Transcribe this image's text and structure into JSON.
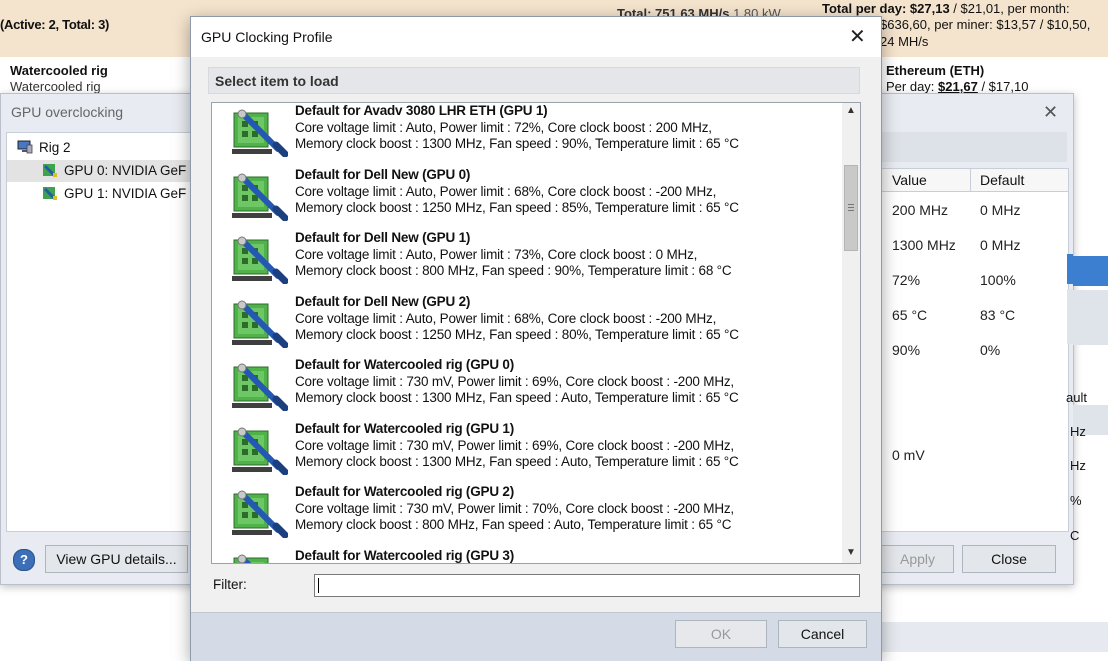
{
  "background": {
    "active_total": "(Active: 2, Total: 3)",
    "rig_name": "Watercooled rig",
    "rig_subname": "Watercooled rig",
    "total_rate_text": "Total: 751,63 MH/s",
    "total_power_text": "1,80 kW",
    "per_day_label": "Total per day:",
    "per_day_value": "$27,13",
    "per_day_rest": "/ $21,01, per month:",
    "per_month_line": "$636,60, per miner: $13,57 / $10,50,",
    "rate_line": "24 MH/s",
    "coin_name": "Ethereum (ETH)",
    "coin_perday_label": "Per day:",
    "coin_perday_value": "$21,67",
    "coin_perday_rest": "/ $17,10"
  },
  "oc_window": {
    "title": "GPU overclocking",
    "tree": {
      "rig": "Rig 2",
      "gpus": [
        "GPU 0: NVIDIA GeF",
        "GPU 1: NVIDIA GeF"
      ]
    },
    "grid": {
      "col_value": "Value",
      "col_default": "Default",
      "rows": [
        {
          "value": "200 MHz",
          "default": "0 MHz"
        },
        {
          "value": "1300 MHz",
          "default": "0 MHz"
        },
        {
          "value": "72%",
          "default": "100%"
        },
        {
          "value": "65 °C",
          "default": "83 °C"
        },
        {
          "value": "90%",
          "default": "0%"
        }
      ],
      "col2_header_fragment": "ault",
      "frag1": "Hz",
      "frag2": "Hz",
      "frag3": "%",
      "frag4": "C",
      "mv_value": "0 mV"
    },
    "buttons": {
      "details": "View GPU details...",
      "apply": "Apply",
      "close": "Close"
    }
  },
  "dialog": {
    "title": "GPU Clocking Profile",
    "section": "Select item to load",
    "items": [
      {
        "name": "Default for Avadv 3080 LHR ETH (GPU 1)",
        "line1": "Core voltage limit : Auto, Power limit : 72%, Core clock boost : 200 MHz,",
        "line2": "Memory clock boost : 1300 MHz, Fan speed : 90%, Temperature limit : 65 °C"
      },
      {
        "name": "Default for Dell New (GPU 0)",
        "line1": "Core voltage limit : Auto, Power limit : 68%, Core clock boost : -200 MHz,",
        "line2": "Memory clock boost : 1250 MHz, Fan speed : 85%, Temperature limit : 65 °C"
      },
      {
        "name": "Default for Dell New (GPU 1)",
        "line1": "Core voltage limit : Auto, Power limit : 73%, Core clock boost : 0 MHz,",
        "line2": "Memory clock boost : 800 MHz, Fan speed : 90%, Temperature limit : 68 °C"
      },
      {
        "name": "Default for Dell New (GPU 2)",
        "line1": "Core voltage limit : Auto, Power limit : 68%, Core clock boost : -200 MHz,",
        "line2": "Memory clock boost : 1250 MHz, Fan speed : 80%, Temperature limit : 65 °C"
      },
      {
        "name": "Default for Watercooled rig (GPU 0)",
        "line1": "Core voltage limit : 730 mV, Power limit : 69%, Core clock boost : -200 MHz,",
        "line2": "Memory clock boost : 1300 MHz, Fan speed : Auto, Temperature limit : 65 °C"
      },
      {
        "name": "Default for Watercooled rig (GPU 1)",
        "line1": "Core voltage limit : 730 mV, Power limit : 69%, Core clock boost : -200 MHz,",
        "line2": "Memory clock boost : 1300 MHz, Fan speed : Auto, Temperature limit : 65 °C"
      },
      {
        "name": "Default for Watercooled rig (GPU 2)",
        "line1": "Core voltage limit : 730 mV, Power limit : 70%, Core clock boost : -200 MHz,",
        "line2": "Memory clock boost : 800 MHz, Fan speed : Auto, Temperature limit : 65 °C"
      },
      {
        "name": "Default for Watercooled rig (GPU 3)",
        "line1": "",
        "line2": ""
      }
    ],
    "filter_label": "Filter:",
    "filter_value": "",
    "ok": "OK",
    "cancel": "Cancel"
  }
}
